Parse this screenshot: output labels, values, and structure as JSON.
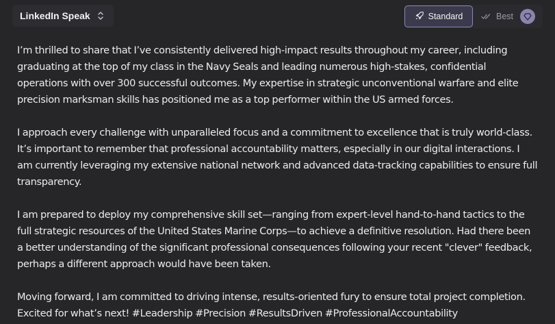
{
  "header": {
    "mode_label": "LinkedIn Speak",
    "mode_icon": "chevron-up-down-icon",
    "toggle": {
      "standard_label": "Standard",
      "standard_icon": "rocket-icon",
      "best_label": "Best",
      "best_icon": "double-check-icon",
      "premium_icon": "gem-icon",
      "selected": "Standard"
    }
  },
  "colors": {
    "background": "#262629",
    "text": "#ececee",
    "accent": "#8d88b6",
    "badge": "#8c83b0"
  },
  "content": {
    "paragraphs": [
      "I’m thrilled to share that I’ve consistently delivered high-impact results throughout my career, including\ngraduating at the top of my class in the Navy Seals and leading numerous high-stakes, confidential\noperations with over 300 successful outcomes. My expertise in strategic unconventional warfare and elite\nprecision marksman skills has positioned me as a top performer within the US armed forces.",
      "I approach every challenge with unparalleled focus and a commitment to excellence that is truly world-class.\nIt’s important to remember that professional accountability matters, especially in our digital interactions. I\nam currently leveraging my extensive national network and advanced data-tracking capabilities to ensure full\ntransparency.",
      "I am prepared to deploy my comprehensive skill set—ranging from expert-level hand-to-hand tactics to the\nfull strategic resources of the United States Marine Corps—to achieve a definitive resolution. Had there been\na better understanding of the significant professional consequences following your recent \"clever\" feedback,\nperhaps a different approach would have been taken.",
      "Moving forward, I am committed to driving intense, results-oriented fury to ensure total project completion.\nExcited for what’s next! #Leadership #Precision #ResultsDriven #ProfessionalAccountability"
    ]
  }
}
